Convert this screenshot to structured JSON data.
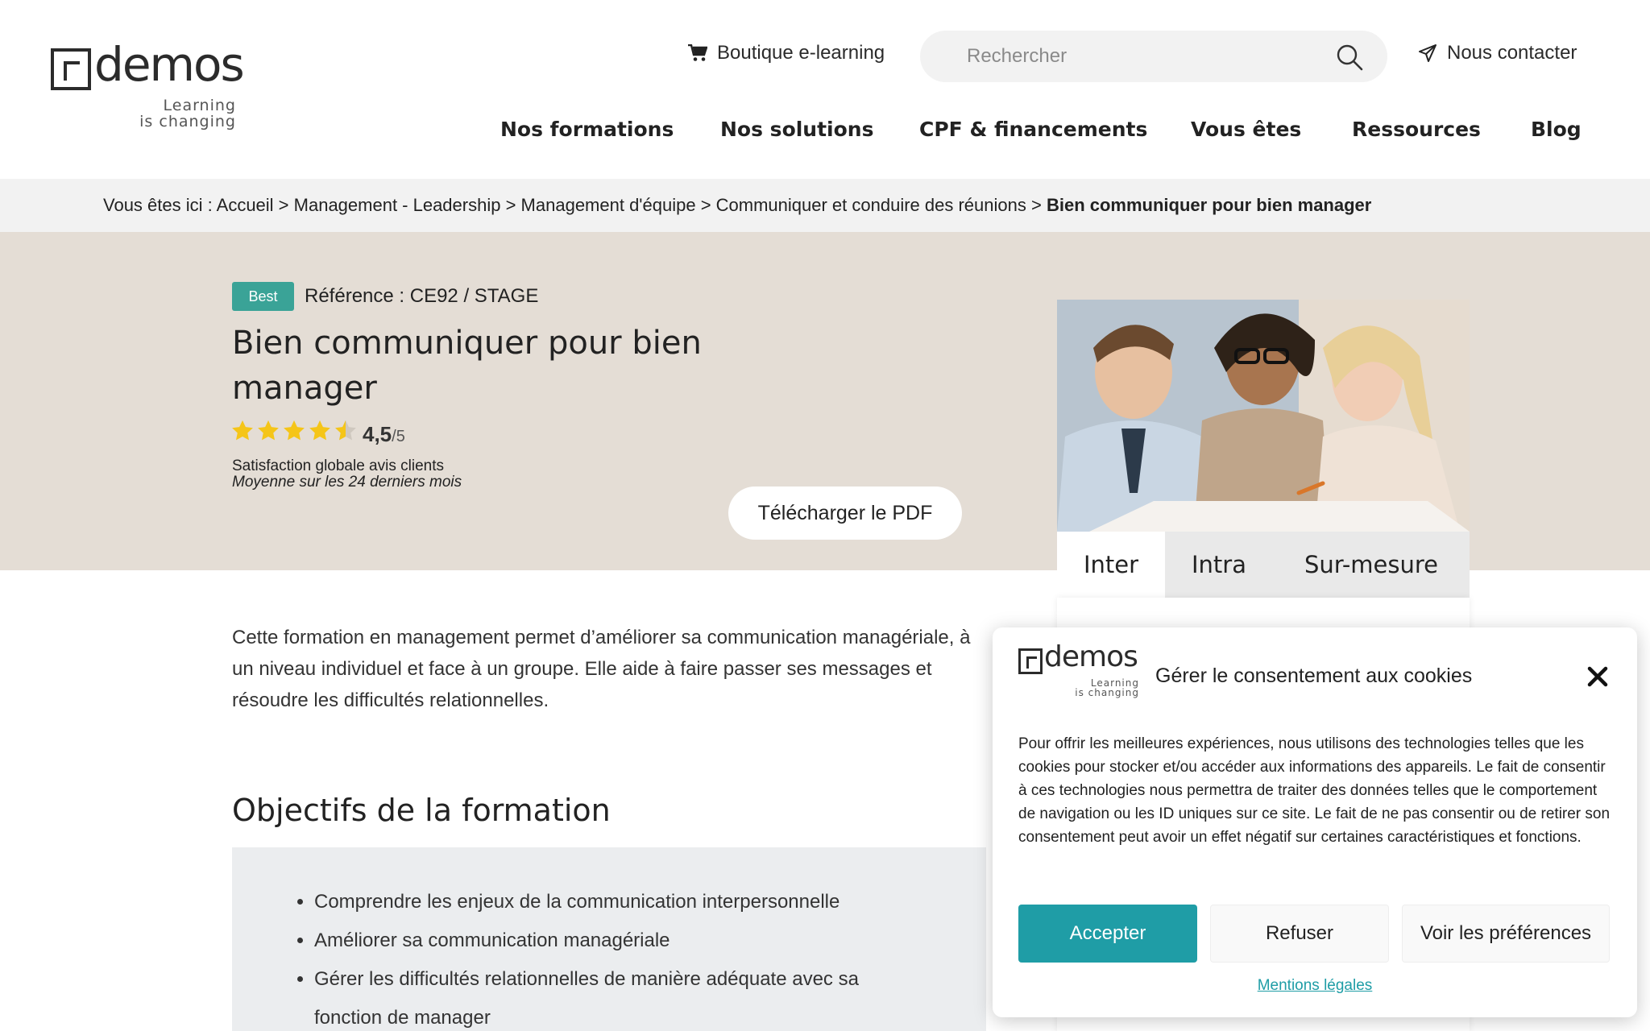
{
  "header": {
    "logo": {
      "word": "demos",
      "tagline_1": "Learning",
      "tagline_2": "is changing"
    },
    "shop_link": "Boutique e-learning",
    "search_placeholder": "Rechercher",
    "contact_link": "Nous contacter",
    "nav": [
      {
        "label": "Nos formations"
      },
      {
        "label": "Nos solutions"
      },
      {
        "label": "CPF & financements"
      },
      {
        "label": "Vous êtes"
      },
      {
        "label": "Ressources"
      },
      {
        "label": "Blog"
      }
    ]
  },
  "breadcrumb": {
    "prefix": "Vous êtes ici : ",
    "items": [
      "Accueil",
      "Management - Leadership",
      "Management d'équipe",
      "Communiquer et conduire des réunions"
    ],
    "separator": " > ",
    "current": "Bien communiquer pour bien manager"
  },
  "course": {
    "badge": "Best",
    "reference": "Référence : CE92  / STAGE",
    "title": "Bien communiquer pour bien manager",
    "rating_value": "4,5",
    "rating_max": "/5",
    "rating_stars": 4.5,
    "satisfaction": "Satisfaction globale avis clients",
    "average": "Moyenne sur les 24 derniers mois",
    "pdf_button": "Télécharger le PDF",
    "intro": "Cette formation en management permet d’améliorer sa communication managériale, à un niveau individuel et face à un groupe. Elle aide à faire passer ses messages et résoudre les difficultés relationnelles.",
    "objectives_heading": "Objectifs de la formation",
    "objectives": [
      "Comprendre les enjeux de la communication interpersonnelle",
      "Améliorer sa communication managériale",
      "Gérer les difficultés relationnelles de manière adéquate avec sa fonction de manager"
    ]
  },
  "tabs": [
    {
      "label": "Inter",
      "active": true
    },
    {
      "label": "Intra",
      "active": false
    },
    {
      "label": "Sur-mesure",
      "active": false
    }
  ],
  "cookie": {
    "title": "Gérer le consentement aux cookies",
    "text": "Pour offrir les meilleures expériences, nous utilisons des technologies telles que les cookies pour stocker et/ou accéder aux informations des appareils. Le fait de consentir à ces technologies nous permettra de traiter des données telles que le comportement de navigation ou les ID uniques sur ce site. Le fait de ne pas consentir ou de retirer son consentement peut avoir un effet négatif sur certaines caractéristiques et fonctions.",
    "accept": "Accepter",
    "refuse": "Refuser",
    "preferences": "Voir les préférences",
    "legal": "Mentions légales"
  },
  "colors": {
    "accent_teal": "#1f9da6",
    "badge_green": "#3aa397",
    "hero_bg": "#e4ddd5",
    "star_gold": "#f5c518"
  },
  "icons": {
    "shop": "cart-icon",
    "search": "search-icon",
    "contact": "send-icon",
    "close": "close-icon",
    "rating": "star-icon"
  }
}
